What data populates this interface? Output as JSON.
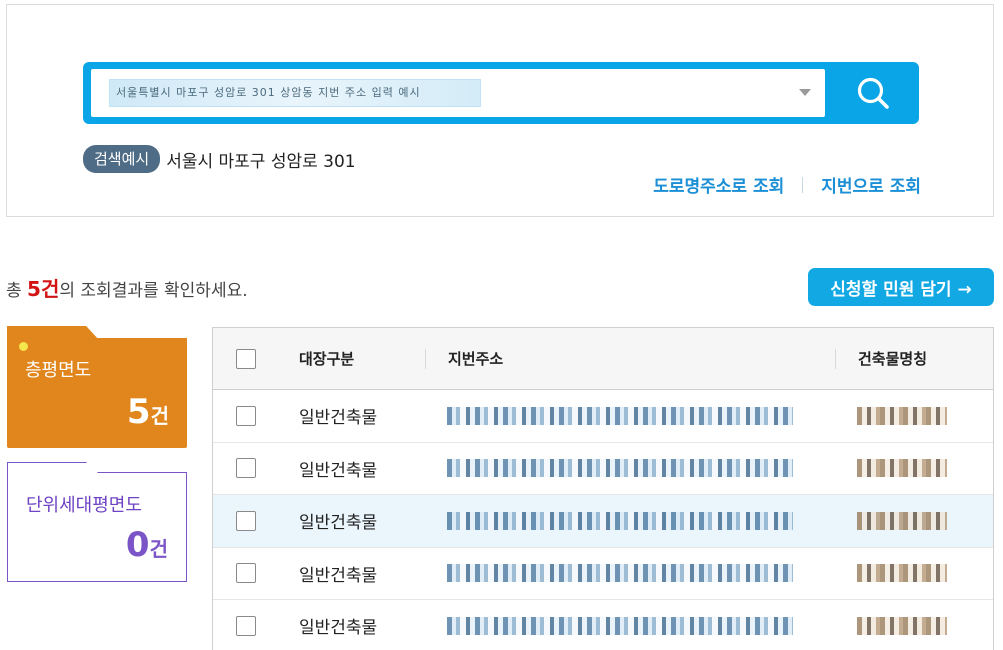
{
  "search": {
    "value": "서울특별시 마포구 성암로 301 상암동 지번 주소 입력 예시",
    "example_badge": "검색예시",
    "example_text": "서울시 마포구 성암로 301",
    "links": [
      "도로명주소로 조회",
      "지번으로 조회"
    ]
  },
  "results": {
    "count_prefix": "총 ",
    "count_num": "5건",
    "count_suffix": "의 조회결과를 확인하세요.",
    "apply_button": "신청할 민원 담기 →"
  },
  "cards": {
    "floor": {
      "label": "층평면도",
      "count": "5",
      "unit": "건"
    },
    "unit": {
      "label": "단위세대평면도",
      "count": "0",
      "unit": "건"
    }
  },
  "table": {
    "headers": {
      "type": "대장구분",
      "address": "지번주소",
      "building": "건축물명칭"
    },
    "rows": [
      {
        "type": "일반건축물"
      },
      {
        "type": "일반건축물"
      },
      {
        "type": "일반건축물"
      },
      {
        "type": "일반건축물"
      },
      {
        "type": "일반건축물"
      }
    ]
  },
  "colors": {
    "accent": "#0aa5e6",
    "floor_card": "#e0861c",
    "unit_card": "#7b55c8",
    "count_red": "#d21414"
  }
}
